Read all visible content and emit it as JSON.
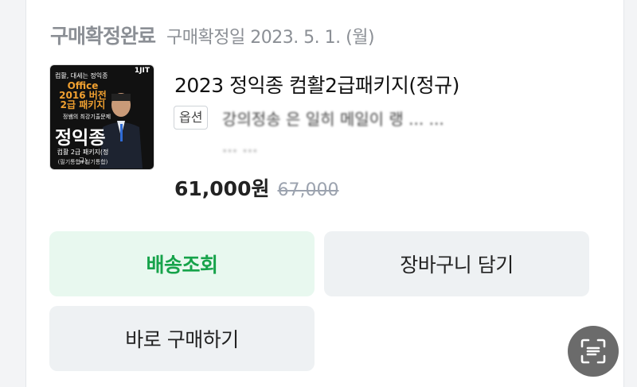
{
  "order": {
    "status": "구매확정완료",
    "confirm_date": "구매확정일 2023. 5. 1. (월)"
  },
  "product": {
    "title": "2023 정익종 컴활2급패키지(정규)",
    "option_label": "옵션",
    "option_text_line1": "강의정송 은 일히 메일이 랭 ...  ...",
    "option_text_line2": "...  ...",
    "price": "61,000원",
    "original_price": "67,000",
    "thumbnail": {
      "top_text": "컴활, 대세는 정익종",
      "logo": "1JIT",
      "office_lines": [
        "Office",
        "2016 버전",
        "2급 패키지"
      ],
      "sub_text": "정쌤의 최강기출문제",
      "name": "정익종",
      "package_text": "컴활 2급 패키지(정규)",
      "package_sub": "(필기통합+실기통합)"
    }
  },
  "actions": {
    "track": "배송조회",
    "add_to_cart": "장바구니 담기",
    "buy_now": "바로 구매하기"
  },
  "fab": {
    "icon": "scan-icon"
  },
  "colors": {
    "accent_green": "#16a34a",
    "accent_green_bg": "#e8f8ef",
    "gray_button_bg": "#eef1f3"
  }
}
